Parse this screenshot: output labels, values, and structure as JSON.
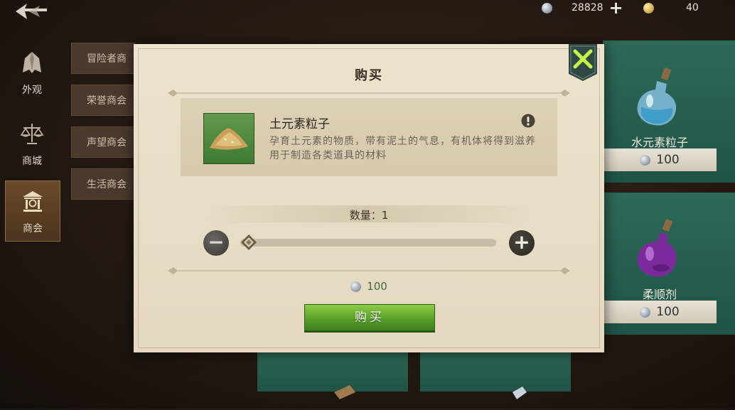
{
  "topbar": {
    "silver_amount": "28828",
    "gold_amount": "40",
    "add_symbol": "+"
  },
  "nav": {
    "items": [
      {
        "label": "外观"
      },
      {
        "label": "商城"
      },
      {
        "label": "商会"
      }
    ]
  },
  "guild_tabs": [
    {
      "label": "冒险者商"
    },
    {
      "label": "荣誉商会"
    },
    {
      "label": "声望商会"
    },
    {
      "label": "生活商会"
    }
  ],
  "goods": [
    {
      "name": "水元素粒子",
      "price": "100",
      "icon": "blue-potion-icon"
    },
    {
      "name": "柔顺剂",
      "price": "100",
      "icon": "purple-potion-icon"
    }
  ],
  "modal": {
    "title": "购买",
    "item_name": "土元素粒子",
    "item_desc": "孕育土元素的物质，带有泥土的气息，有机体将得到滋养\n用于制造各类道具的材料",
    "quantity_label": "数量：",
    "quantity": "1",
    "slider_fraction": 0.0,
    "minus_symbol": "−",
    "plus_symbol": "+",
    "cost": "100",
    "buy_label": "购买"
  },
  "colors": {
    "accent_green": "#5aa02a",
    "card_green": "#2d6a58",
    "parchment": "#e8dfc7"
  }
}
